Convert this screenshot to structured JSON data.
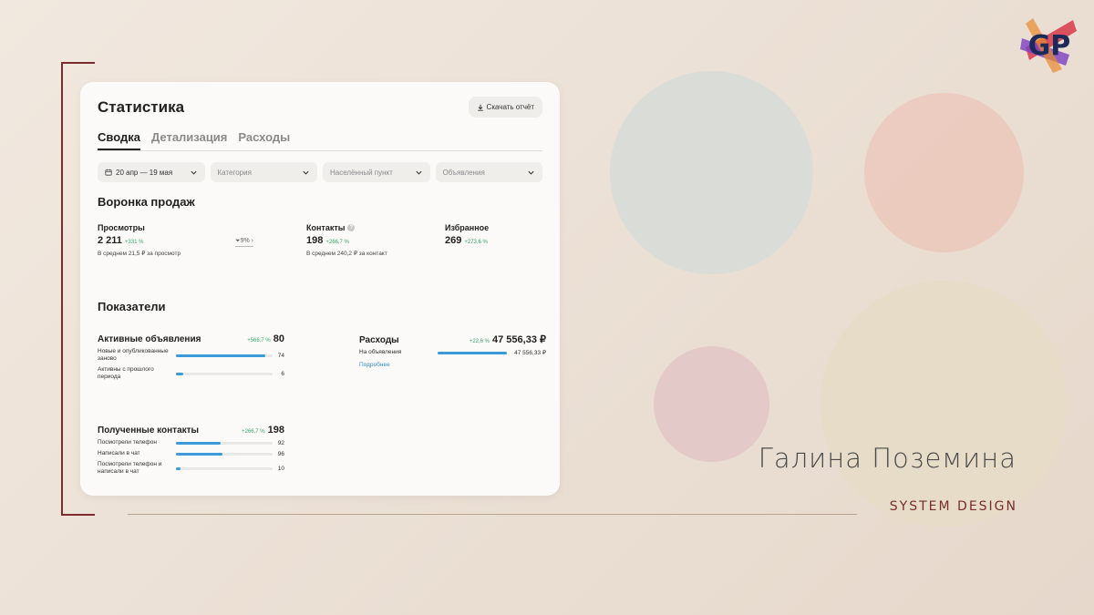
{
  "presentation": {
    "author": "Галина Поземина",
    "subtitle": "SYSTEM DESIGN",
    "logo_text": "GP"
  },
  "card": {
    "title": "Статистика",
    "download_label": "Скачать отчёт",
    "tabs": [
      {
        "label": "Сводка",
        "active": true
      },
      {
        "label": "Детализация",
        "active": false
      },
      {
        "label": "Расходы",
        "active": false
      }
    ],
    "filters": {
      "date": "20 апр — 19 мая",
      "category": "Категория",
      "location": "Населённый пункт",
      "ads": "Объявления"
    },
    "funnel": {
      "title": "Воронка продаж",
      "views": {
        "name": "Просмотры",
        "value": "2 211",
        "change": "+331 %",
        "note": "В среднем 21,5 ₽ за просмотр"
      },
      "conversion": "9%",
      "contacts": {
        "name": "Контакты",
        "value": "198",
        "change": "+266,7 %",
        "note": "В среднем 240,2 ₽ за контакт"
      },
      "favorites": {
        "name": "Избранное",
        "value": "269",
        "change": "+273,6 %"
      }
    },
    "indicators": {
      "title": "Показатели",
      "active_ads": {
        "name": "Активные объявления",
        "change": "+566,7 %",
        "total": "80",
        "rows": [
          {
            "label": "Новые и опубликованные заново",
            "value": "74",
            "fill": 0.925
          },
          {
            "label": "Активны с прошлого периода",
            "value": "6",
            "fill": 0.075
          }
        ]
      },
      "expenses": {
        "name": "Расходы",
        "change": "+22,6 %",
        "total": "47 556,33 ₽",
        "rows": [
          {
            "label": "На объявления",
            "value": "47 556,33 ₽",
            "fill": 1.0
          }
        ],
        "link": "Подробнее"
      },
      "contacts": {
        "name": "Полученные контакты",
        "change": "+266,7 %",
        "total": "198",
        "rows": [
          {
            "label": "Посмотрели телефон",
            "value": "92",
            "fill": 0.46
          },
          {
            "label": "Написали в чат",
            "value": "96",
            "fill": 0.48
          },
          {
            "label": "Посмотрели телефон и написали в чат",
            "value": "10",
            "fill": 0.05
          }
        ]
      }
    }
  },
  "colors": {
    "accent_bar": "#3b9bd8",
    "positive": "#3aa56b",
    "bracket": "#7a2d2d"
  }
}
